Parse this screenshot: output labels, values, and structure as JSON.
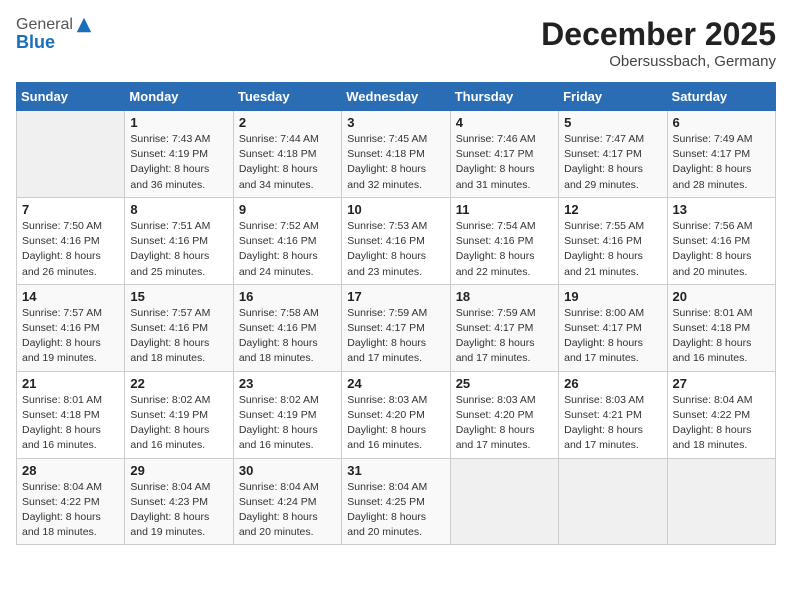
{
  "header": {
    "logo_line1": "General",
    "logo_line2": "Blue",
    "month": "December 2025",
    "location": "Obersussbach, Germany"
  },
  "weekdays": [
    "Sunday",
    "Monday",
    "Tuesday",
    "Wednesday",
    "Thursday",
    "Friday",
    "Saturday"
  ],
  "weeks": [
    [
      {
        "day": "",
        "info": ""
      },
      {
        "day": "1",
        "info": "Sunrise: 7:43 AM\nSunset: 4:19 PM\nDaylight: 8 hours\nand 36 minutes."
      },
      {
        "day": "2",
        "info": "Sunrise: 7:44 AM\nSunset: 4:18 PM\nDaylight: 8 hours\nand 34 minutes."
      },
      {
        "day": "3",
        "info": "Sunrise: 7:45 AM\nSunset: 4:18 PM\nDaylight: 8 hours\nand 32 minutes."
      },
      {
        "day": "4",
        "info": "Sunrise: 7:46 AM\nSunset: 4:17 PM\nDaylight: 8 hours\nand 31 minutes."
      },
      {
        "day": "5",
        "info": "Sunrise: 7:47 AM\nSunset: 4:17 PM\nDaylight: 8 hours\nand 29 minutes."
      },
      {
        "day": "6",
        "info": "Sunrise: 7:49 AM\nSunset: 4:17 PM\nDaylight: 8 hours\nand 28 minutes."
      }
    ],
    [
      {
        "day": "7",
        "info": "Sunrise: 7:50 AM\nSunset: 4:16 PM\nDaylight: 8 hours\nand 26 minutes."
      },
      {
        "day": "8",
        "info": "Sunrise: 7:51 AM\nSunset: 4:16 PM\nDaylight: 8 hours\nand 25 minutes."
      },
      {
        "day": "9",
        "info": "Sunrise: 7:52 AM\nSunset: 4:16 PM\nDaylight: 8 hours\nand 24 minutes."
      },
      {
        "day": "10",
        "info": "Sunrise: 7:53 AM\nSunset: 4:16 PM\nDaylight: 8 hours\nand 23 minutes."
      },
      {
        "day": "11",
        "info": "Sunrise: 7:54 AM\nSunset: 4:16 PM\nDaylight: 8 hours\nand 22 minutes."
      },
      {
        "day": "12",
        "info": "Sunrise: 7:55 AM\nSunset: 4:16 PM\nDaylight: 8 hours\nand 21 minutes."
      },
      {
        "day": "13",
        "info": "Sunrise: 7:56 AM\nSunset: 4:16 PM\nDaylight: 8 hours\nand 20 minutes."
      }
    ],
    [
      {
        "day": "14",
        "info": "Sunrise: 7:57 AM\nSunset: 4:16 PM\nDaylight: 8 hours\nand 19 minutes."
      },
      {
        "day": "15",
        "info": "Sunrise: 7:57 AM\nSunset: 4:16 PM\nDaylight: 8 hours\nand 18 minutes."
      },
      {
        "day": "16",
        "info": "Sunrise: 7:58 AM\nSunset: 4:16 PM\nDaylight: 8 hours\nand 18 minutes."
      },
      {
        "day": "17",
        "info": "Sunrise: 7:59 AM\nSunset: 4:17 PM\nDaylight: 8 hours\nand 17 minutes."
      },
      {
        "day": "18",
        "info": "Sunrise: 7:59 AM\nSunset: 4:17 PM\nDaylight: 8 hours\nand 17 minutes."
      },
      {
        "day": "19",
        "info": "Sunrise: 8:00 AM\nSunset: 4:17 PM\nDaylight: 8 hours\nand 17 minutes."
      },
      {
        "day": "20",
        "info": "Sunrise: 8:01 AM\nSunset: 4:18 PM\nDaylight: 8 hours\nand 16 minutes."
      }
    ],
    [
      {
        "day": "21",
        "info": "Sunrise: 8:01 AM\nSunset: 4:18 PM\nDaylight: 8 hours\nand 16 minutes."
      },
      {
        "day": "22",
        "info": "Sunrise: 8:02 AM\nSunset: 4:19 PM\nDaylight: 8 hours\nand 16 minutes."
      },
      {
        "day": "23",
        "info": "Sunrise: 8:02 AM\nSunset: 4:19 PM\nDaylight: 8 hours\nand 16 minutes."
      },
      {
        "day": "24",
        "info": "Sunrise: 8:03 AM\nSunset: 4:20 PM\nDaylight: 8 hours\nand 16 minutes."
      },
      {
        "day": "25",
        "info": "Sunrise: 8:03 AM\nSunset: 4:20 PM\nDaylight: 8 hours\nand 17 minutes."
      },
      {
        "day": "26",
        "info": "Sunrise: 8:03 AM\nSunset: 4:21 PM\nDaylight: 8 hours\nand 17 minutes."
      },
      {
        "day": "27",
        "info": "Sunrise: 8:04 AM\nSunset: 4:22 PM\nDaylight: 8 hours\nand 18 minutes."
      }
    ],
    [
      {
        "day": "28",
        "info": "Sunrise: 8:04 AM\nSunset: 4:22 PM\nDaylight: 8 hours\nand 18 minutes."
      },
      {
        "day": "29",
        "info": "Sunrise: 8:04 AM\nSunset: 4:23 PM\nDaylight: 8 hours\nand 19 minutes."
      },
      {
        "day": "30",
        "info": "Sunrise: 8:04 AM\nSunset: 4:24 PM\nDaylight: 8 hours\nand 20 minutes."
      },
      {
        "day": "31",
        "info": "Sunrise: 8:04 AM\nSunset: 4:25 PM\nDaylight: 8 hours\nand 20 minutes."
      },
      {
        "day": "",
        "info": ""
      },
      {
        "day": "",
        "info": ""
      },
      {
        "day": "",
        "info": ""
      }
    ]
  ]
}
